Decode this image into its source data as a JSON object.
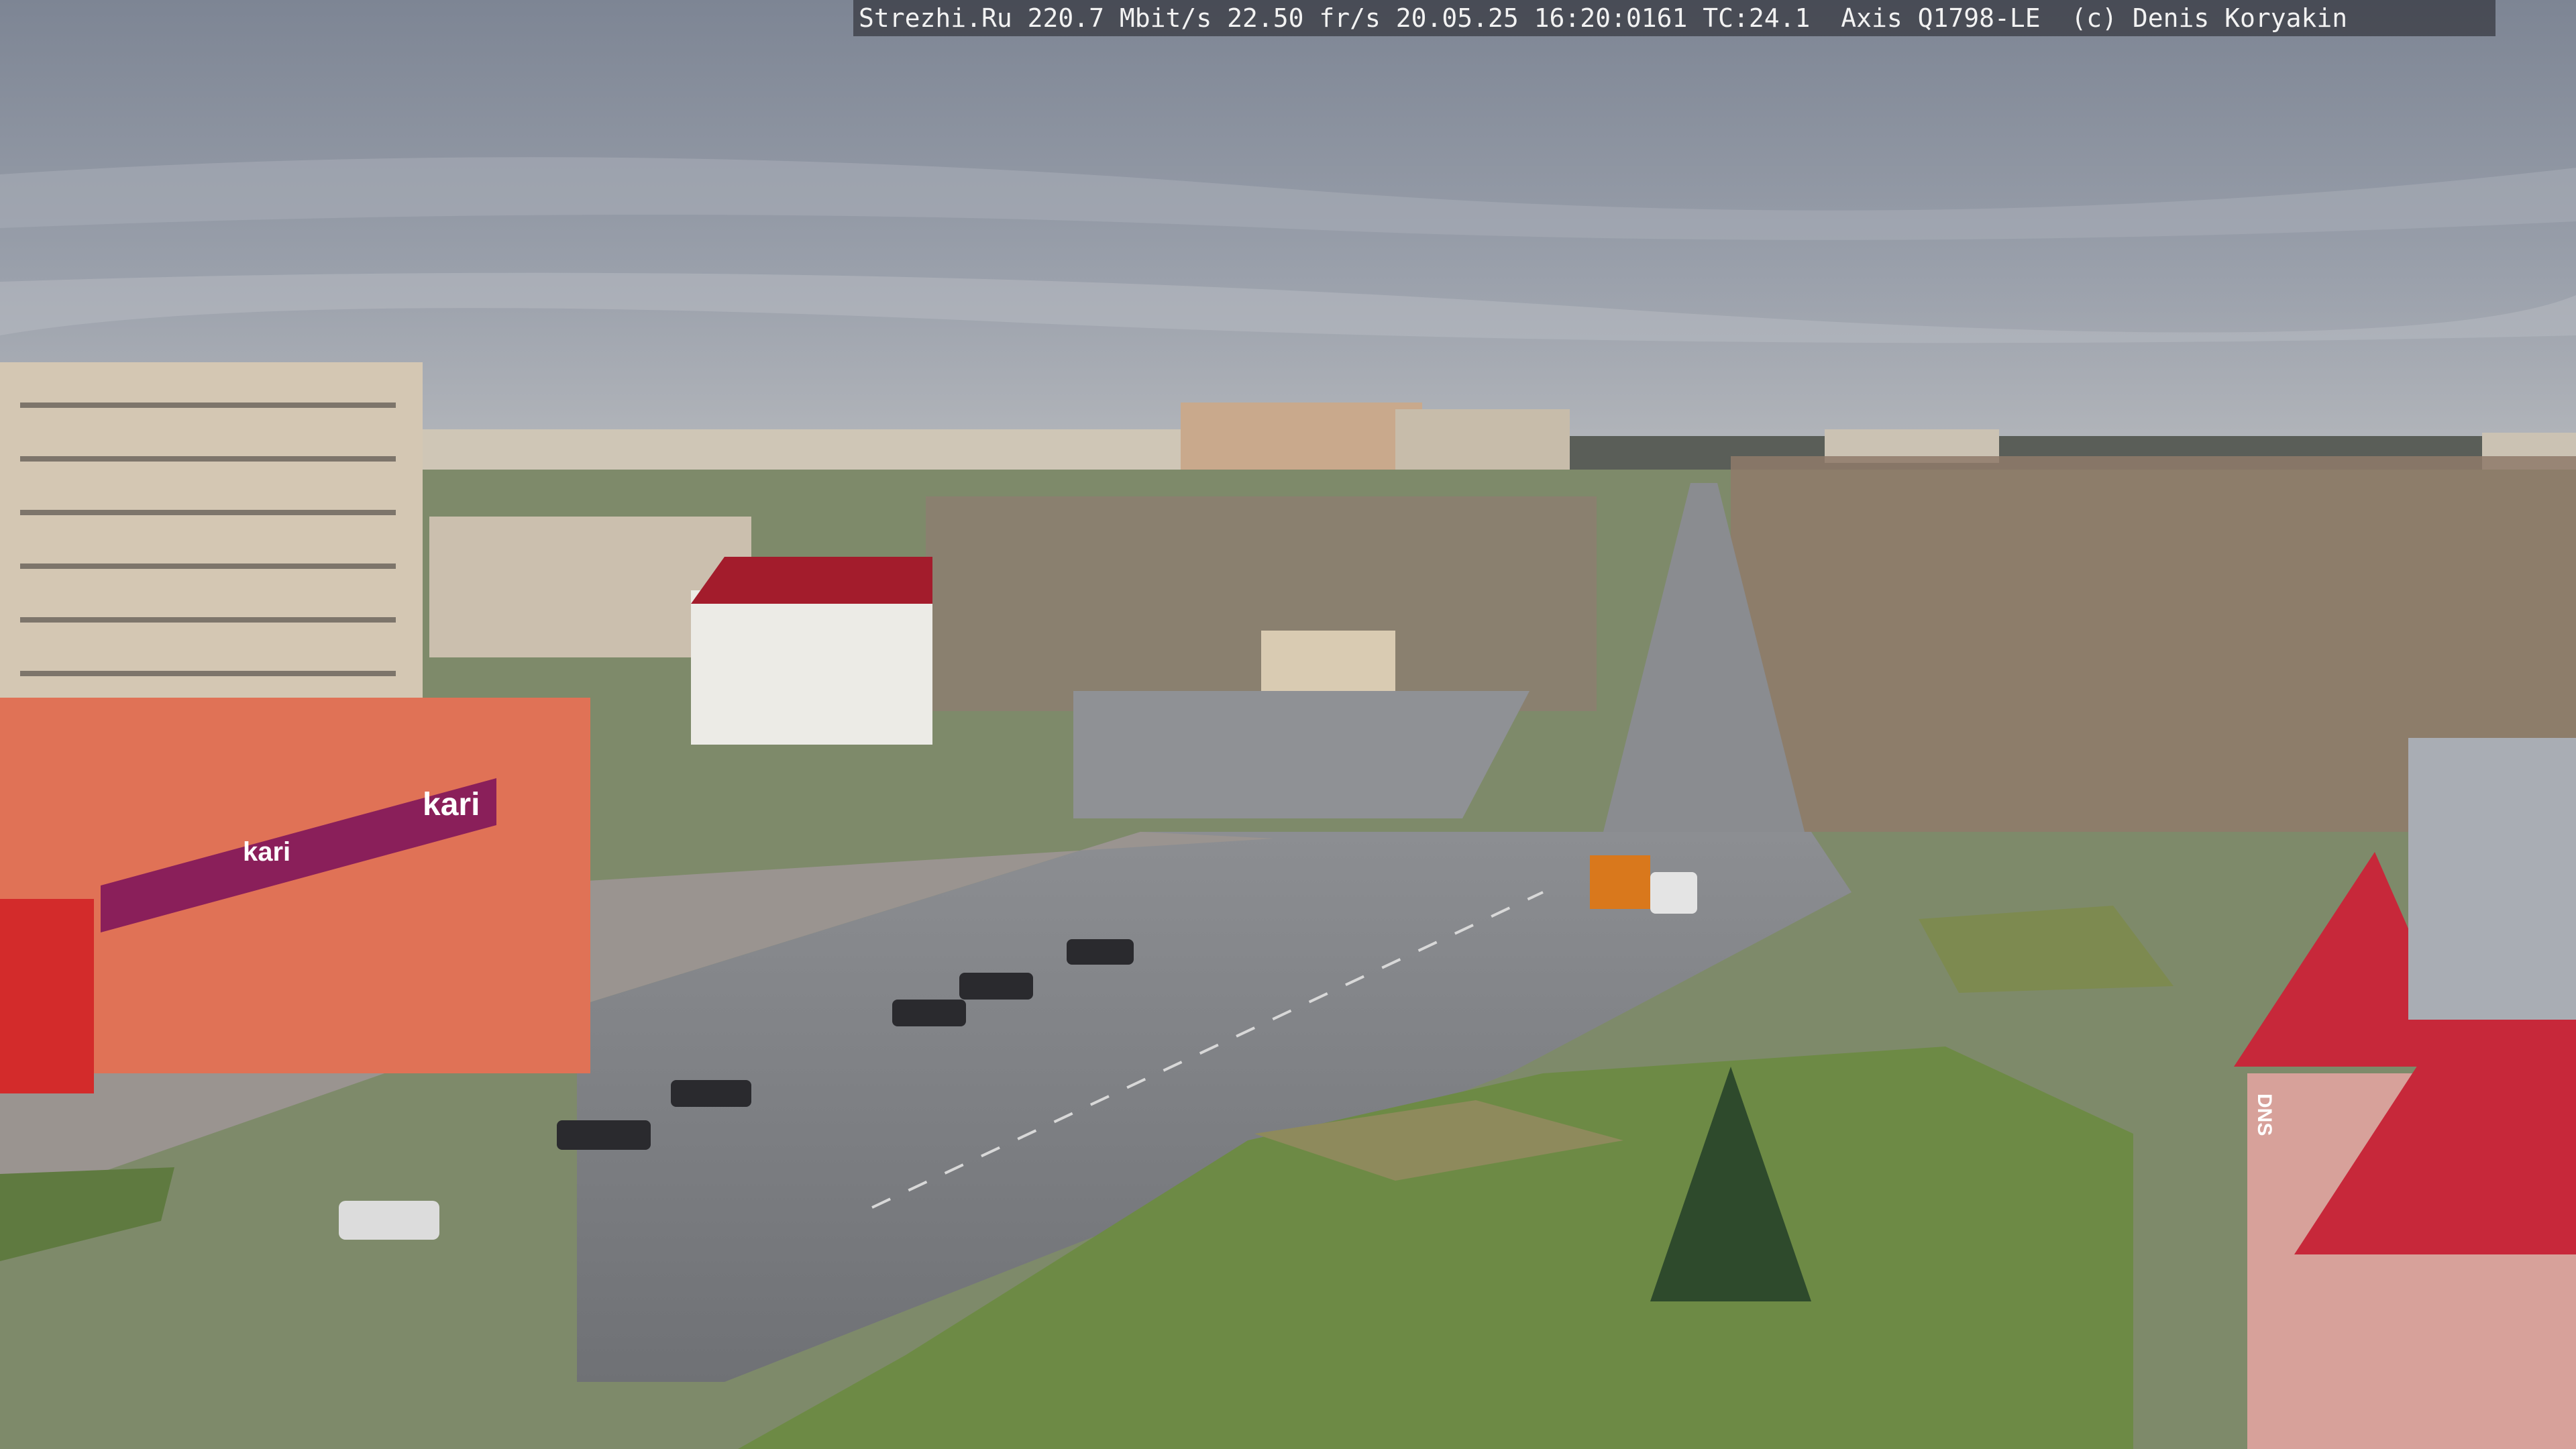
{
  "overlay": {
    "camera_caption": "Strezhi.Ru 220.7 Mbit/s 22.50 fr/s 20.05.25 16:20:0161 TC:24.1  Axis Q1798-LE  (c) Denis Koryakin"
  },
  "signs": {
    "store_left": "kari",
    "store_left_small": "kari",
    "store_right": "DNS"
  },
  "colors": {
    "sky": "#8d95a3",
    "asphalt": "#7d7f83",
    "grass": "#6f8a4a",
    "roof_red": "#c4283a",
    "store_orange": "#e5765a",
    "kari_purple": "#8a1f5a"
  }
}
